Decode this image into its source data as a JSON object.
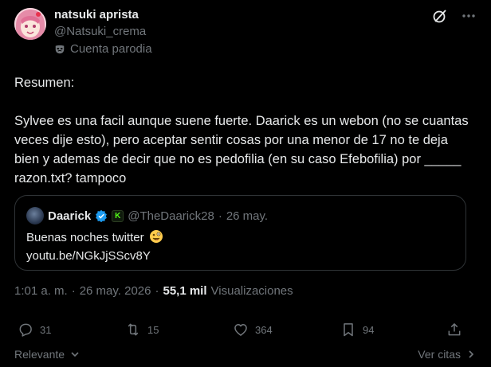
{
  "post": {
    "author_name": "natsuki aprista",
    "author_handle": "@Natsuki_crema",
    "label": "Cuenta parodia",
    "text": "Resumen:\n\nSylvee es una facil aunque suene fuerte. Daarick es un webon (no se cuantas veces dije esto), pero aceptar sentir cosas por una menor de 17 no te deja bien y ademas de decir que no es pedofilia (en su caso Efebofilia) por _____ razon.txt? tampoco",
    "time": "1:01 a. m.",
    "date": "26 may. 2026",
    "views_count": "55,1 mil",
    "views_label": "Visualizaciones"
  },
  "quote": {
    "author_name": "Daarick",
    "affiliate_badge": "K",
    "author_handle": "@TheDaarick28",
    "date": "26 may.",
    "line1": "Buenas noches twitter",
    "line2": "youtu.be/NGkJjSScv8Y"
  },
  "actions": {
    "replies": "31",
    "reposts": "15",
    "likes": "364",
    "bookmarks": "94"
  },
  "footer": {
    "sort_label": "Relevante",
    "quotes_label": "Ver citas"
  },
  "icons": {
    "header": [
      "grok-icon",
      "more-icon"
    ],
    "parody": "mask-icon",
    "actions": [
      "reply-icon",
      "repost-icon",
      "like-icon",
      "bookmark-icon",
      "share-icon"
    ]
  },
  "colors": {
    "background": "#000000",
    "text": "#e7e9ea",
    "muted": "#71767b",
    "border": "#2f3336",
    "verified": "#1d9bf0",
    "affiliate": "#53fc18"
  }
}
